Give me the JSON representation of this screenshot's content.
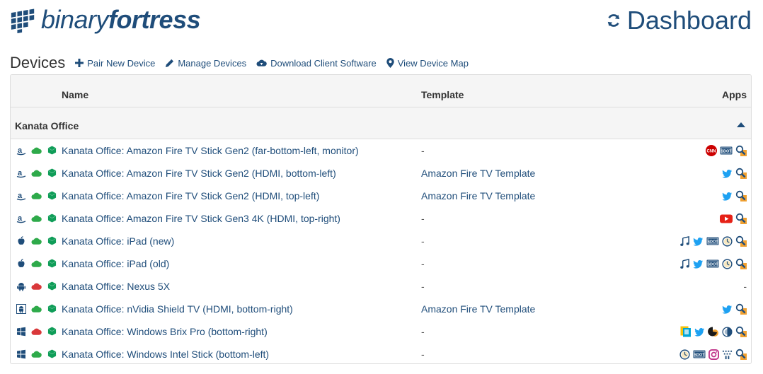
{
  "brand": {
    "light": "binary",
    "bold": "fortress"
  },
  "page_title": "Dashboard",
  "section_title": "Devices",
  "toolbar": [
    {
      "label": "Pair New Device",
      "icon": "plus-icon"
    },
    {
      "label": "Manage Devices",
      "icon": "pencil-icon"
    },
    {
      "label": "Download Client Software",
      "icon": "cloud-download-icon"
    },
    {
      "label": "View Device Map",
      "icon": "map-marker-icon"
    }
  ],
  "columns": {
    "name": "Name",
    "template": "Template",
    "apps": "Apps"
  },
  "group": {
    "label": "Kanata Office"
  },
  "colors": {
    "brand": "#1f4d7a",
    "online": "#2eaa4a",
    "offline": "#d9383a",
    "active": "#0f9d58"
  },
  "rows": [
    {
      "name": "Kanata Office: Amazon Fire TV Stick Gen2 (far-bottom-left, monitor)",
      "template": "-",
      "platform": "amazon",
      "cloud": "online",
      "apps": [
        "cnn",
        "sdot",
        "search"
      ]
    },
    {
      "name": "Kanata Office: Amazon Fire TV Stick Gen2 (HDMI, bottom-left)",
      "template": "Amazon Fire TV Template",
      "platform": "amazon",
      "cloud": "online",
      "apps": [
        "twitter",
        "search"
      ]
    },
    {
      "name": "Kanata Office: Amazon Fire TV Stick Gen2 (HDMI, top-left)",
      "template": "Amazon Fire TV Template",
      "platform": "amazon",
      "cloud": "online",
      "apps": [
        "twitter",
        "search"
      ]
    },
    {
      "name": "Kanata Office: Amazon Fire TV Stick Gen3 4K (HDMI, top-right)",
      "template": "-",
      "platform": "amazon",
      "cloud": "online",
      "apps": [
        "youtube",
        "search"
      ]
    },
    {
      "name": "Kanata Office: iPad (new)",
      "template": "-",
      "platform": "apple",
      "cloud": "online",
      "apps": [
        "music",
        "twitter",
        "sdot",
        "clock",
        "search"
      ]
    },
    {
      "name": "Kanata Office: iPad (old)",
      "template": "-",
      "platform": "apple",
      "cloud": "online",
      "apps": [
        "music",
        "twitter",
        "sdot",
        "clock",
        "search"
      ]
    },
    {
      "name": "Kanata Office: Nexus 5X",
      "template": "-",
      "platform": "android",
      "cloud": "offline",
      "apps": [],
      "apps_text": "-"
    },
    {
      "name": "Kanata Office: nVidia Shield TV (HDMI, bottom-right)",
      "template": "Amazon Fire TV Template",
      "platform": "android-box",
      "cloud": "online",
      "apps": [
        "twitter",
        "search"
      ]
    },
    {
      "name": "Kanata Office: Windows Brix Pro (bottom-right)",
      "template": "-",
      "platform": "windows",
      "cloud": "offline",
      "apps": [
        "tiles",
        "twitter",
        "pacman",
        "pie",
        "search"
      ]
    },
    {
      "name": "Kanata Office: Windows Intel Stick (bottom-left)",
      "template": "-",
      "platform": "windows",
      "cloud": "online",
      "apps": [
        "clock",
        "sdot",
        "instagram",
        "dots",
        "search"
      ]
    }
  ]
}
